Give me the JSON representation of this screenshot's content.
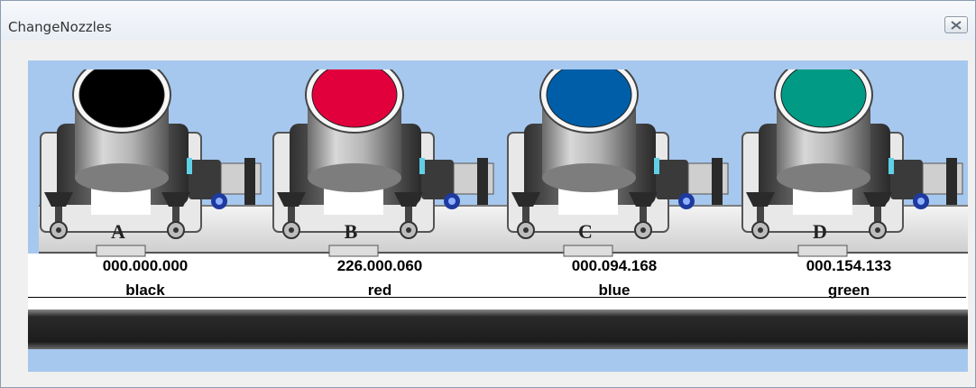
{
  "window": {
    "title": "ChangeNozzles"
  },
  "nozzles": [
    {
      "letter": "A",
      "code": "000.000.000",
      "color_name": "black",
      "cap_color": "#000000"
    },
    {
      "letter": "B",
      "code": "226.000.060",
      "color_name": "red",
      "cap_color": "#e2003c"
    },
    {
      "letter": "C",
      "code": "000.094.168",
      "color_name": "blue",
      "cap_color": "#005ea8"
    },
    {
      "letter": "D",
      "code": "000.154.133",
      "color_name": "green",
      "cap_color": "#009a85"
    }
  ],
  "icons": {
    "close": "close-icon"
  }
}
